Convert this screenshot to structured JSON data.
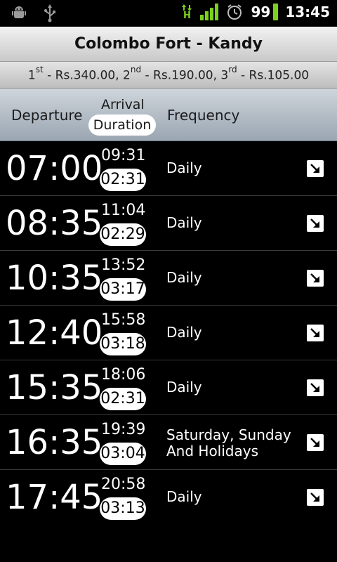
{
  "status_bar": {
    "left_icons": [
      "android-debug-icon",
      "usb-icon"
    ],
    "network_type": "H",
    "battery_level": "99",
    "time": "13:45"
  },
  "header": {
    "title": "Colombo Fort - Kandy",
    "fares": [
      {
        "class_num": "1",
        "ordinal_suffix": "st",
        "price": " - Rs.340.00, "
      },
      {
        "class_num": "2",
        "ordinal_suffix": "nd",
        "price": " - Rs.190.00, "
      },
      {
        "class_num": "3",
        "ordinal_suffix": "rd",
        "price": " - Rs.105.00"
      }
    ]
  },
  "columns": {
    "departure": "Departure",
    "arrival": "Arrival",
    "duration": "Duration",
    "frequency": "Frequency"
  },
  "trains": [
    {
      "departure": "07:00",
      "arrival": "09:31",
      "duration": "02:31",
      "frequency": "Daily"
    },
    {
      "departure": "08:35",
      "arrival": "11:04",
      "duration": "02:29",
      "frequency": "Daily"
    },
    {
      "departure": "10:35",
      "arrival": "13:52",
      "duration": "03:17",
      "frequency": "Daily"
    },
    {
      "departure": "12:40",
      "arrival": "15:58",
      "duration": "03:18",
      "frequency": "Daily"
    },
    {
      "departure": "15:35",
      "arrival": "18:06",
      "duration": "02:31",
      "frequency": "Daily"
    },
    {
      "departure": "16:35",
      "arrival": "19:39",
      "duration": "03:04",
      "frequency_line1": "Saturday, Sunday",
      "frequency_line2": "And Holidays"
    },
    {
      "departure": "17:45",
      "arrival": "20:58",
      "duration": "03:13",
      "frequency": "Daily"
    }
  ],
  "colors": {
    "network_green": "#7cd11a",
    "row_bg": "#000000",
    "header_bg": "#c9c9c9"
  }
}
